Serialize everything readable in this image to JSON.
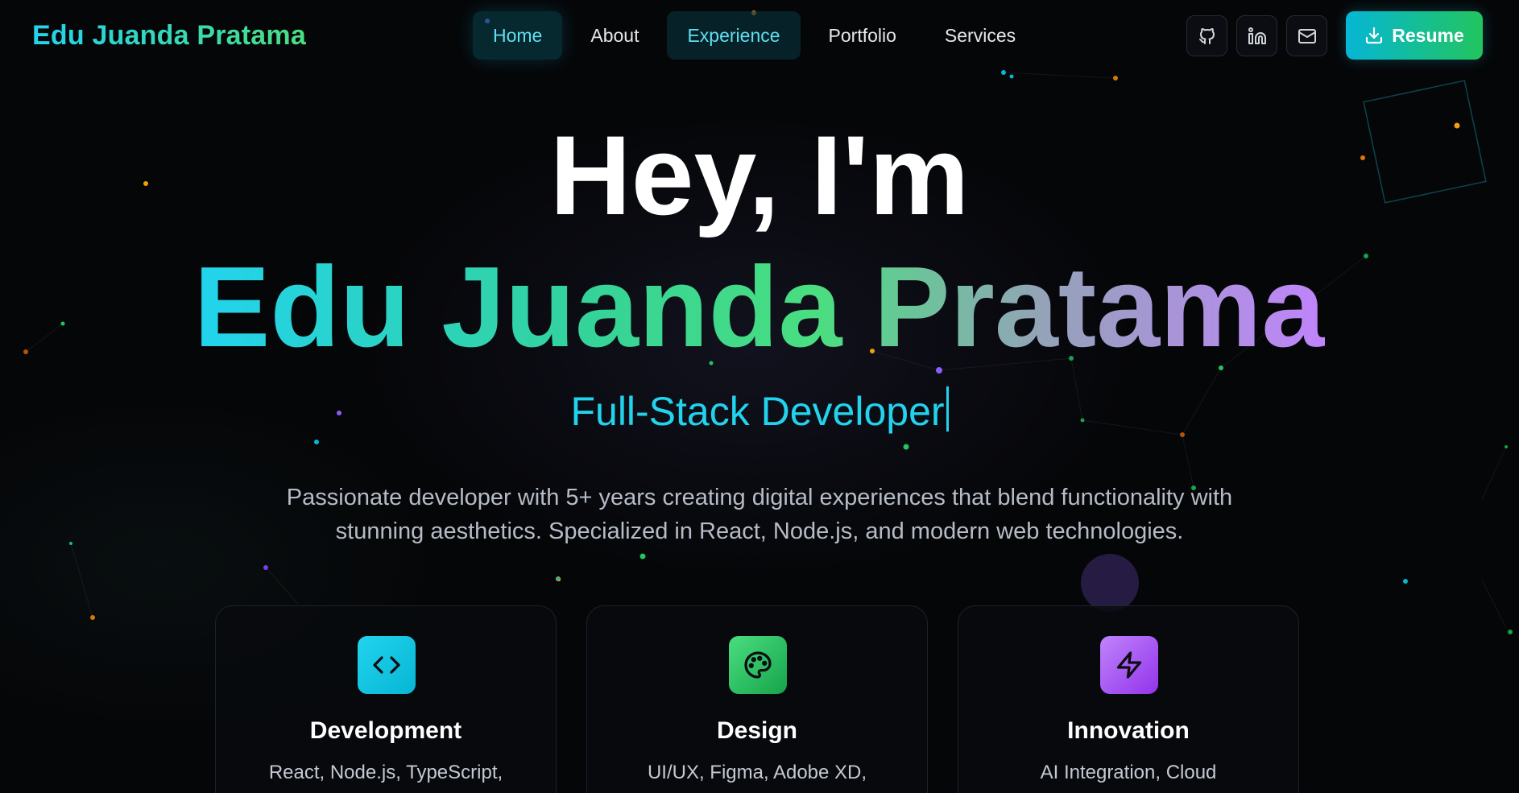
{
  "nav": {
    "brand": "Edu Juanda Pratama",
    "links": [
      {
        "label": "Home"
      },
      {
        "label": "About"
      },
      {
        "label": "Experience"
      },
      {
        "label": "Portfolio"
      },
      {
        "label": "Services"
      }
    ],
    "socials": [
      {
        "icon": "github-icon"
      },
      {
        "icon": "linkedin-icon"
      },
      {
        "icon": "mail-icon"
      }
    ],
    "resume_label": "Resume"
  },
  "hero": {
    "greeting": "Hey, I'm",
    "name": "Edu Juanda Pratama",
    "role": "Full-Stack Developer",
    "description": "Passionate developer with 5+ years creating digital experiences that blend functionality with stunning aesthetics. Specialized in React, Node.js, and modern web technologies."
  },
  "cards": [
    {
      "icon": "code-icon",
      "title": "Development",
      "text": "React, Node.js, TypeScript,",
      "color": "#06b6d4"
    },
    {
      "icon": "palette-icon",
      "title": "Design",
      "text": "UI/UX, Figma, Adobe XD,",
      "color": "#22c55e"
    },
    {
      "icon": "zap-icon",
      "title": "Innovation",
      "text": "AI Integration, Cloud",
      "color": "#a855f7"
    }
  ],
  "colors": {
    "background": "#050608",
    "accent_cyan": "#22d3ee",
    "accent_green": "#4ade80",
    "accent_purple": "#c084fc"
  }
}
